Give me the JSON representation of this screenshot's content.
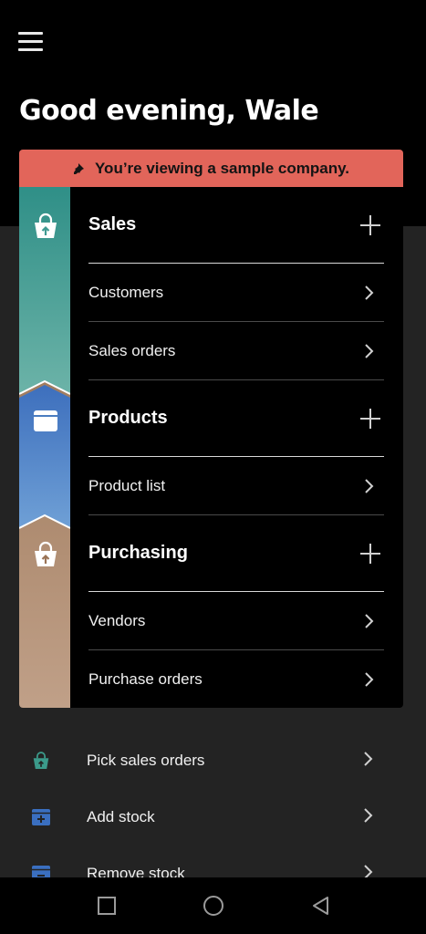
{
  "header": {
    "menu_icon": "hamburger-icon",
    "greeting": "Good evening, Wale"
  },
  "banner": {
    "icon": "pin-icon",
    "text": "You’re viewing a sample company.",
    "color": "#e2655a"
  },
  "sections": [
    {
      "title": "Sales",
      "icon": "shopping-bag-up-icon",
      "color": "#3f9a92",
      "items": [
        "Customers",
        "Sales orders"
      ]
    },
    {
      "title": "Products",
      "icon": "box-icon",
      "color": "#4a7cc0",
      "items": [
        "Product list"
      ]
    },
    {
      "title": "Purchasing",
      "icon": "shopping-bag-up-icon",
      "color": "#9a7355",
      "items": [
        "Vendors",
        "Purchase orders"
      ]
    }
  ],
  "quick_actions": [
    {
      "label": "Pick sales orders",
      "icon": "shopping-bag-up-icon",
      "color": "#3b9a8a"
    },
    {
      "label": "Add stock",
      "icon": "box-plus-icon",
      "color": "#3a6fc0"
    },
    {
      "label": "Remove stock",
      "icon": "box-minus-icon",
      "color": "#3a6fc0"
    }
  ],
  "system_nav": {
    "recents": "square-icon",
    "home": "circle-icon",
    "back": "triangle-back-icon"
  }
}
